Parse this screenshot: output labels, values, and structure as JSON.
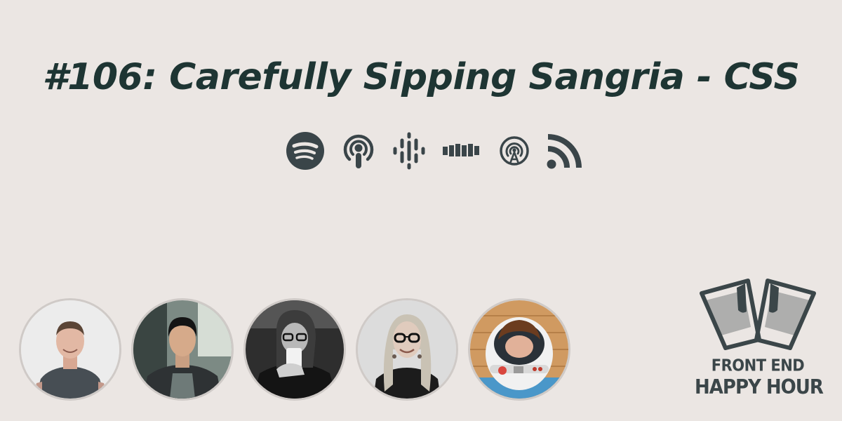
{
  "episode": {
    "title": "#106: Carefully Sipping Sangria - CSS"
  },
  "platforms": [
    {
      "icon": "spotify-icon"
    },
    {
      "icon": "apple-podcasts-icon"
    },
    {
      "icon": "google-podcasts-icon"
    },
    {
      "icon": "castbox-icon"
    },
    {
      "icon": "overcast-icon"
    },
    {
      "icon": "rss-icon"
    }
  ],
  "hosts": [
    {
      "icon": "host-avatar-1"
    },
    {
      "icon": "host-avatar-2"
    },
    {
      "icon": "host-avatar-3"
    },
    {
      "icon": "host-avatar-4"
    },
    {
      "icon": "host-avatar-5"
    }
  ],
  "brand": {
    "line1": "FRONT END",
    "line2": "HAPPY HOUR"
  },
  "colors": {
    "background": "#ebe6e3",
    "title": "#1e3533",
    "icon": "#3a4549",
    "brand": "#3b4649"
  }
}
